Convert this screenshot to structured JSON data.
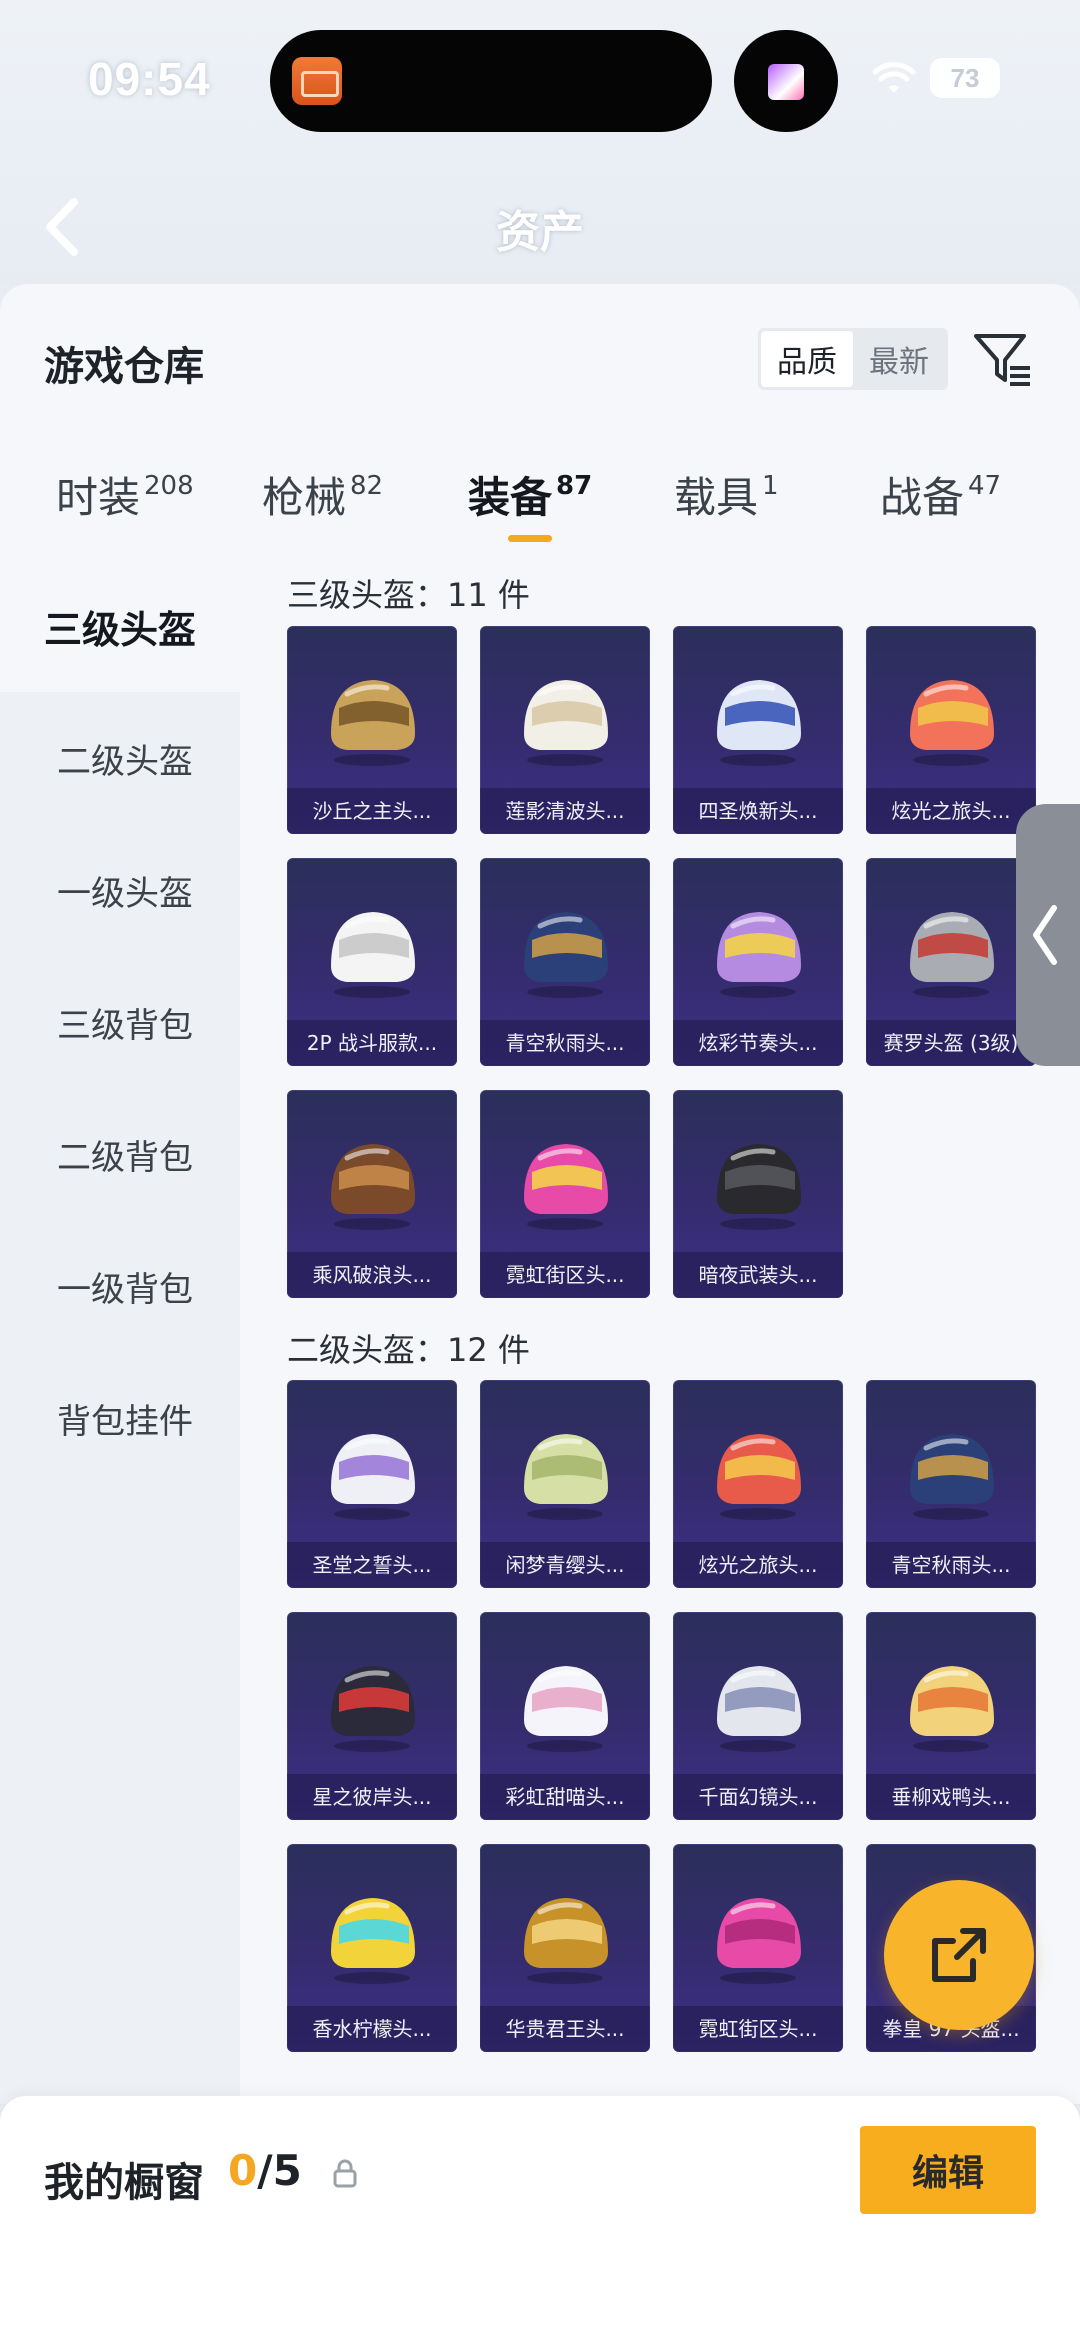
{
  "status_bar": {
    "time": "09:54",
    "battery": "73"
  },
  "nav": {
    "title": "资产"
  },
  "warehouse": {
    "title": "游戏仓库",
    "sort_options": [
      "品质",
      "最新"
    ],
    "active_sort": "品质"
  },
  "category_tabs": [
    {
      "label": "时装",
      "count": "208"
    },
    {
      "label": "枪械",
      "count": "82"
    },
    {
      "label": "装备",
      "count": "87",
      "active": true
    },
    {
      "label": "载具",
      "count": "1"
    },
    {
      "label": "战备",
      "count": "47"
    }
  ],
  "sidebar": {
    "items": [
      {
        "label": "三级头盔",
        "active": true
      },
      {
        "label": "二级头盔"
      },
      {
        "label": "一级头盔"
      },
      {
        "label": "三级背包"
      },
      {
        "label": "二级背包"
      },
      {
        "label": "一级背包"
      },
      {
        "label": "背包挂件"
      }
    ]
  },
  "sections": [
    {
      "title": "三级头盔：11 件",
      "items": [
        {
          "name": "沙丘之主头...",
          "colors": [
            "#c9a35a",
            "#7a5a2a"
          ]
        },
        {
          "name": "莲影清波头...",
          "colors": [
            "#f2efe6",
            "#d8c9a6"
          ]
        },
        {
          "name": "四圣焕新头...",
          "colors": [
            "#dfe6f5",
            "#3a56b8"
          ]
        },
        {
          "name": "炫光之旅头...",
          "colors": [
            "#f2725a",
            "#f2c44a"
          ]
        },
        {
          "name": "2P 战斗服款...",
          "colors": [
            "#f4f4f4",
            "#c8c8c8"
          ]
        },
        {
          "name": "青空秋雨头...",
          "colors": [
            "#2b3f78",
            "#c89a4a"
          ]
        },
        {
          "name": "炫彩节奏头...",
          "colors": [
            "#b48be0",
            "#f2d24a"
          ]
        },
        {
          "name": "赛罗头盔 (3级)",
          "colors": [
            "#a9adb3",
            "#c2403a"
          ]
        },
        {
          "name": "乘风破浪头...",
          "colors": [
            "#7a4a2a",
            "#c88a4a"
          ]
        },
        {
          "name": "霓虹街区头...",
          "colors": [
            "#e84aa8",
            "#f2d24a"
          ]
        },
        {
          "name": "暗夜武装头...",
          "colors": [
            "#2a2a2e",
            "#55565c"
          ]
        }
      ]
    },
    {
      "title": "二级头盔：12 件",
      "items": [
        {
          "name": "圣堂之誓头...",
          "colors": [
            "#eef0f6",
            "#9a7ad8"
          ]
        },
        {
          "name": "闲梦青缨头...",
          "colors": [
            "#d6e0a6",
            "#a8b870"
          ]
        },
        {
          "name": "炫光之旅头...",
          "colors": [
            "#e85a4a",
            "#f2c44a"
          ]
        },
        {
          "name": "青空秋雨头...",
          "colors": [
            "#2b3f78",
            "#c89a4a"
          ]
        },
        {
          "name": "星之彼岸头...",
          "colors": [
            "#2a2a3a",
            "#d83a3a"
          ]
        },
        {
          "name": "彩虹甜喵头...",
          "colors": [
            "#f4f4fa",
            "#e8a8c8"
          ]
        },
        {
          "name": "千面幻镜头...",
          "colors": [
            "#e4e6ee",
            "#8a94b8"
          ]
        },
        {
          "name": "垂柳戏鸭头...",
          "colors": [
            "#f2d27a",
            "#e87a3a"
          ]
        },
        {
          "name": "香水柠檬头...",
          "colors": [
            "#f2d43a",
            "#4ad8e8"
          ]
        },
        {
          "name": "华贵君王头...",
          "colors": [
            "#c8922a",
            "#f2d27a"
          ]
        },
        {
          "name": "霓虹街区头...",
          "colors": [
            "#e84aa8",
            "#b02a7a"
          ]
        },
        {
          "name": "拳皇 97 头盔...",
          "colors": [
            "#f2a83a",
            "#7a4a2a"
          ]
        }
      ]
    }
  ],
  "showcase": {
    "label": "我的橱窗",
    "current": "0",
    "total": "/5",
    "edit_label": "编辑"
  },
  "colors": {
    "accent": "#f5a623",
    "item_bg": "#352c6e",
    "edit_button": "#f8ad1e"
  }
}
